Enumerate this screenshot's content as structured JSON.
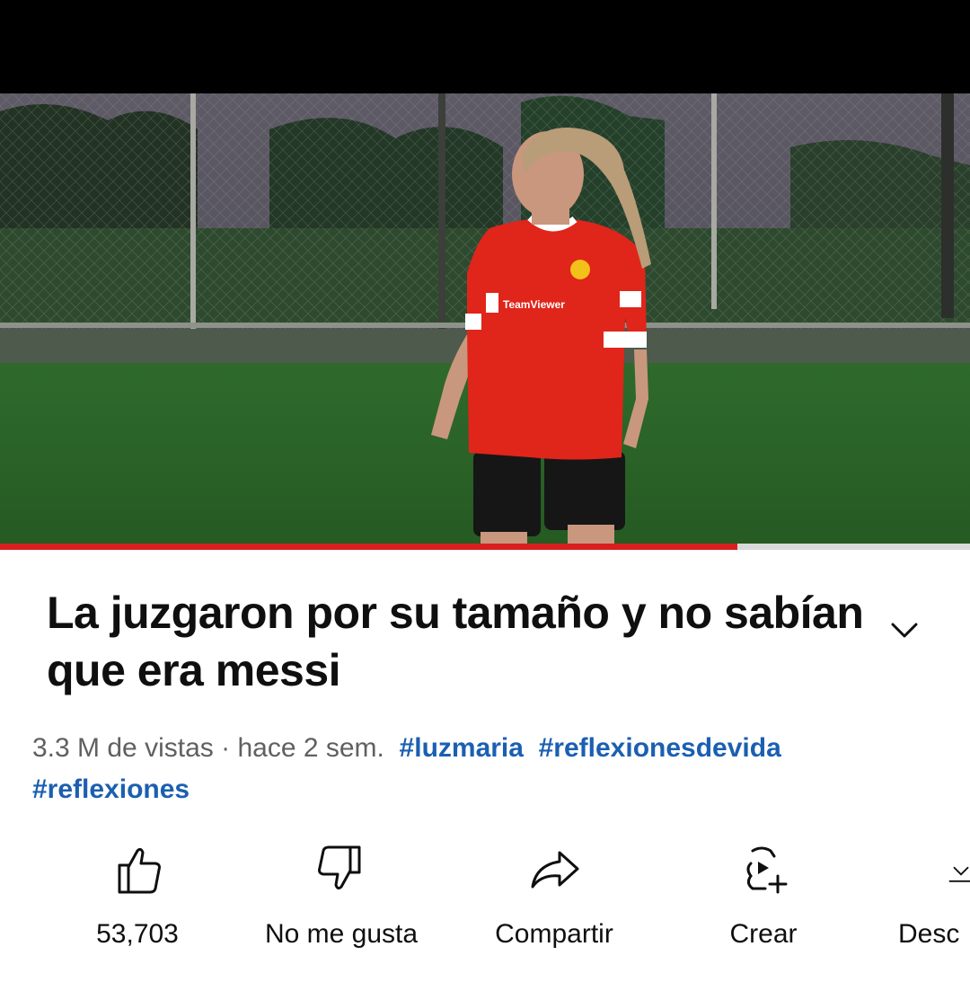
{
  "video": {
    "progress": 0.76,
    "jersey_text": "TeamViewer",
    "player_image": "woman in red football jersey on grass field at night"
  },
  "details": {
    "title": "La juzgaron por su tamaño y no sabían que era messi",
    "views": "3.3 M de vistas",
    "separator": "·",
    "age": "hace 2 sem.",
    "hashtags": [
      "#luzmaria",
      "#reflexionesdevida",
      "#reflexiones"
    ]
  },
  "actions": [
    {
      "label": "53,703",
      "icon": "thumbs-up-icon"
    },
    {
      "label": "No me gusta",
      "icon": "thumbs-down-icon"
    },
    {
      "label": "Compartir",
      "icon": "share-icon"
    },
    {
      "label": "Crear",
      "icon": "create-icon"
    },
    {
      "label": "Desc",
      "icon": "download-icon"
    }
  ],
  "colors": {
    "progress_red": "#d81f1f",
    "hashtag_blue": "#1b5fb1",
    "jersey_red": "#e0251a"
  }
}
